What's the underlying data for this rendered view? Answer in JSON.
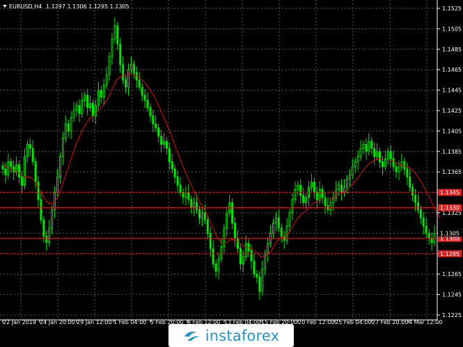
{
  "header": {
    "symbol": "EURUSD,H4",
    "ohlc": "1.1297 1.1306 1.1295 1.1305"
  },
  "watermark": {
    "text": "instaforex"
  },
  "colors": {
    "background": "#000000",
    "bull_candle": "#00e600",
    "bear_candle": "#00e600",
    "moving_average": "#e01010",
    "level_line": "#e02020",
    "current_price_tag": "#ffffff",
    "grid": "#5a5a5a",
    "watermark_text": "#1d97c9"
  },
  "chart_data": {
    "type": "line",
    "subtype": "candlestick",
    "title": "EURUSD,H4",
    "ylim": [
      1.1225,
      1.1525
    ],
    "y_ticks": [
      "1.1525",
      "1.1505",
      "1.1485",
      "1.1465",
      "1.1445",
      "1.1425",
      "1.1405",
      "1.1385",
      "1.1365",
      "1.1345",
      "1.1325",
      "1.1305",
      "1.1285",
      "1.1265",
      "1.1245",
      "1.1225"
    ],
    "x_ticks": [
      "22 Jan 2019",
      "24 Jan 20:00",
      "29 Jan 12:00",
      "1 Feb 04:00",
      "5 Feb 20:00",
      "8 Feb 12:00",
      "13 Feb 04:00",
      "15 Feb 20:00",
      "20 Feb 12:00",
      "25 Feb 04:00",
      "27 Feb 20:00",
      "4 Mar 12:00"
    ],
    "grid": true,
    "levels": [
      {
        "price": 1.1345,
        "label": "1.1345"
      },
      {
        "price": 1.133,
        "label": "1.1330"
      },
      {
        "price": 1.13,
        "label": "1.1300"
      },
      {
        "price": 1.1285,
        "label": "1.1285"
      }
    ],
    "current_price": {
      "price": 1.1305,
      "label": "1.1305"
    },
    "series": [
      {
        "name": "EURUSD,H4",
        "kind": "close",
        "values": [
          1.1368,
          1.1362,
          1.1375,
          1.137,
          1.1365,
          1.1372,
          1.136,
          1.1352,
          1.138,
          1.1392,
          1.1388,
          1.1375,
          1.1355,
          1.1338,
          1.1318,
          1.1302,
          1.1296,
          1.131,
          1.1328,
          1.1345,
          1.136,
          1.138,
          1.1398,
          1.1412,
          1.1405,
          1.1418,
          1.1425,
          1.143,
          1.1422,
          1.1435,
          1.144,
          1.1428,
          1.1432,
          1.142,
          1.143,
          1.1445,
          1.1438,
          1.145,
          1.146,
          1.1478,
          1.1495,
          1.1508,
          1.149,
          1.147,
          1.1455,
          1.1448,
          1.1465,
          1.147,
          1.1462,
          1.1455,
          1.1448,
          1.144,
          1.1435,
          1.1428,
          1.142,
          1.1412,
          1.1408,
          1.14,
          1.1392,
          1.1395,
          1.1388,
          1.1375,
          1.1368,
          1.136,
          1.1352,
          1.1345,
          1.134,
          1.1345,
          1.1338,
          1.133,
          1.1335,
          1.1328,
          1.132,
          1.1325,
          1.1318,
          1.1305,
          1.129,
          1.1275,
          1.1268,
          1.128,
          1.1292,
          1.131,
          1.1325,
          1.1335,
          1.1315,
          1.13,
          1.129,
          1.1275,
          1.1282,
          1.1295,
          1.1288,
          1.1278,
          1.1265,
          1.1262,
          1.1248,
          1.127,
          1.1285,
          1.1295,
          1.1305,
          1.1315,
          1.132,
          1.131,
          1.1302,
          1.1298,
          1.1312,
          1.1325,
          1.1338,
          1.1348,
          1.1352,
          1.1342,
          1.1335,
          1.134,
          1.135,
          1.1355,
          1.1345,
          1.1338,
          1.1348,
          1.134,
          1.1332,
          1.1328,
          1.1335,
          1.134,
          1.1348,
          1.1352,
          1.1345,
          1.135,
          1.1358,
          1.1362,
          1.137,
          1.1375,
          1.138,
          1.1388,
          1.1392,
          1.1385,
          1.1395,
          1.1388,
          1.138,
          1.1385,
          1.1375,
          1.137,
          1.1378,
          1.1385,
          1.1378,
          1.137,
          1.1365,
          1.137,
          1.1375,
          1.1368,
          1.136,
          1.135,
          1.1342,
          1.1335,
          1.1328,
          1.132,
          1.1312,
          1.1305,
          1.13,
          1.1296,
          1.1305
        ]
      },
      {
        "name": "MA",
        "kind": "moving-average",
        "values": [
          1.1372,
          1.137,
          1.1369,
          1.1368,
          1.1367,
          1.1366,
          1.1364,
          1.1361,
          1.136,
          1.136,
          1.136,
          1.1358,
          1.1355,
          1.135,
          1.1345,
          1.134,
          1.1336,
          1.1334,
          1.1334,
          1.1336,
          1.134,
          1.1346,
          1.1354,
          1.1362,
          1.137,
          1.1378,
          1.1386,
          1.1393,
          1.1399,
          1.1405,
          1.141,
          1.1414,
          1.1418,
          1.142,
          1.1422,
          1.1425,
          1.1428,
          1.1431,
          1.1435,
          1.144,
          1.1446,
          1.1452,
          1.1456,
          1.1458,
          1.1459,
          1.146,
          1.1461,
          1.1461,
          1.146,
          1.1459,
          1.1457,
          1.1455,
          1.1452,
          1.1449,
          1.1445,
          1.1441,
          1.1436,
          1.143,
          1.1424,
          1.1418,
          1.1412,
          1.1405,
          1.1398,
          1.1391,
          1.1384,
          1.1377,
          1.137,
          1.1364,
          1.1358,
          1.1352,
          1.1346,
          1.1341,
          1.1336,
          1.1331,
          1.1327,
          1.1322,
          1.1316,
          1.131,
          1.1304,
          1.1299,
          1.1296,
          1.1295,
          1.1296,
          1.1298,
          1.1299,
          1.1298,
          1.1297,
          1.1295,
          1.1293,
          1.1292,
          1.1291,
          1.129,
          1.1288,
          1.1286,
          1.1283,
          1.1282,
          1.1282,
          1.1284,
          1.1287,
          1.1291,
          1.1296,
          1.1299,
          1.1301,
          1.1302,
          1.1304,
          1.1307,
          1.1311,
          1.1316,
          1.132,
          1.1323,
          1.1325,
          1.1327,
          1.133,
          1.1333,
          1.1335,
          1.1336,
          1.1338,
          1.1339,
          1.1339,
          1.1339,
          1.1339,
          1.134,
          1.1341,
          1.1343,
          1.1344,
          1.1345,
          1.1347,
          1.135,
          1.1353,
          1.1356,
          1.1359,
          1.1363,
          1.1367,
          1.137,
          1.1373,
          1.1375,
          1.1376,
          1.1378,
          1.1378,
          1.1377,
          1.1377,
          1.1377,
          1.1377,
          1.1376,
          1.1374,
          1.1373,
          1.1372,
          1.1371,
          1.137,
          1.1369,
          1.1367,
          1.1364,
          1.136,
          1.1356,
          1.1351,
          1.1346,
          1.1341,
          1.1335,
          1.133,
          1.1325,
          1.132
        ]
      }
    ]
  }
}
